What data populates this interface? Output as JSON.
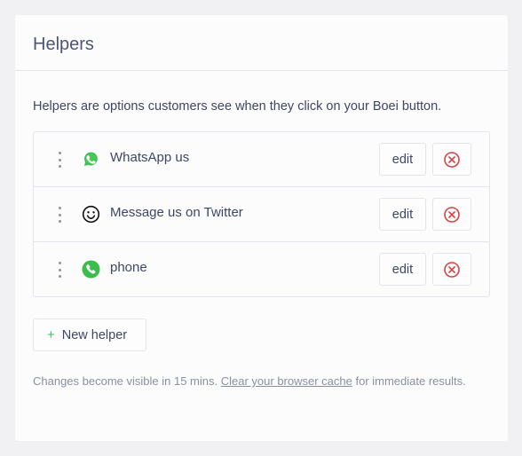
{
  "header": {
    "title": "Helpers"
  },
  "description": "Helpers are options customers see when they click on your Boei button.",
  "helpers": [
    {
      "label": "WhatsApp us",
      "icon": "whatsapp-icon",
      "edit_label": "edit"
    },
    {
      "label": "Message us on Twitter",
      "icon": "smiley-icon",
      "edit_label": "edit"
    },
    {
      "label": "phone",
      "icon": "phone-icon",
      "edit_label": "edit"
    }
  ],
  "new_helper": {
    "label": "New helper",
    "icon": "plus-icon"
  },
  "note": {
    "before": "Changes become visible in 15 mins. ",
    "link": "Clear your browser cache",
    "after": " for immediate results."
  },
  "colors": {
    "accent_green": "#3bbd6a",
    "delete_red": "#d9403f",
    "text": "#3e4663"
  }
}
